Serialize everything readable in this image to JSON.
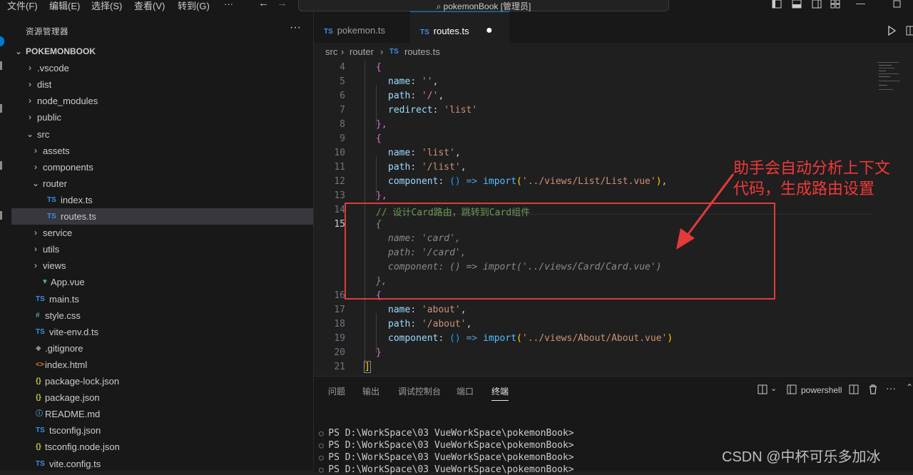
{
  "titlebar": {
    "menus": [
      "文件(F)",
      "编辑(E)",
      "选择(S)",
      "查看(V)",
      "转到(G)",
      "···"
    ],
    "search_text": "pokemonBook [管理员]"
  },
  "sidebar": {
    "title": "资源管理器",
    "more": "···",
    "items": [
      {
        "label": "POKEMONBOOK",
        "chev": "⌄",
        "icon": ""
      },
      {
        "label": ".vscode",
        "chev": "›",
        "icon": ""
      },
      {
        "label": "dist",
        "chev": "›",
        "icon": ""
      },
      {
        "label": "node_modules",
        "chev": "›",
        "icon": ""
      },
      {
        "label": "public",
        "chev": "›",
        "icon": ""
      },
      {
        "label": "src",
        "chev": "⌄",
        "icon": ""
      },
      {
        "label": "assets",
        "chev": "›",
        "icon": ""
      },
      {
        "label": "components",
        "chev": "›",
        "icon": ""
      },
      {
        "label": "router",
        "chev": "⌄",
        "icon": ""
      },
      {
        "label": "index.ts",
        "chev": "",
        "icon": "TS"
      },
      {
        "label": "routes.ts",
        "chev": "",
        "icon": "TS"
      },
      {
        "label": "service",
        "chev": "›",
        "icon": ""
      },
      {
        "label": "utils",
        "chev": "›",
        "icon": ""
      },
      {
        "label": "views",
        "chev": "›",
        "icon": ""
      },
      {
        "label": "App.vue",
        "chev": "",
        "icon": "▼"
      },
      {
        "label": "main.ts",
        "chev": "",
        "icon": "TS"
      },
      {
        "label": "style.css",
        "chev": "",
        "icon": "#"
      },
      {
        "label": "vite-env.d.ts",
        "chev": "",
        "icon": "TS"
      },
      {
        "label": ".gitignore",
        "chev": "",
        "icon": "◆"
      },
      {
        "label": "index.html",
        "chev": "",
        "icon": "<>"
      },
      {
        "label": "package-lock.json",
        "chev": "",
        "icon": "{}"
      },
      {
        "label": "package.json",
        "chev": "",
        "icon": "{}"
      },
      {
        "label": "README.md",
        "chev": "",
        "icon": "ⓘ"
      },
      {
        "label": "tsconfig.json",
        "chev": "",
        "icon": "TS"
      },
      {
        "label": "tsconfig.node.json",
        "chev": "",
        "icon": "{}"
      },
      {
        "label": "vite.config.ts",
        "chev": "",
        "icon": "TS"
      }
    ]
  },
  "tabs": [
    {
      "icon": "TS",
      "label": "pokemon.ts"
    },
    {
      "icon": "TS",
      "label": "routes.ts"
    }
  ],
  "breadcrumb": {
    "a": "src",
    "b": "router",
    "icon": "TS",
    "c": "routes.ts"
  },
  "line_numbers": [
    "4",
    "5",
    "6",
    "7",
    "8",
    "9",
    "10",
    "11",
    "12",
    "13",
    "14",
    "15",
    "16",
    "17",
    "18",
    "19",
    "20",
    "21"
  ],
  "code": {
    "l4": "{",
    "l5_key": "name",
    "l5_val": "''",
    "l6_key": "path",
    "l6_val": "'/'",
    "l7_key": "redirect",
    "l7_val": "'list'",
    "l8": "},",
    "l9": "{",
    "l10_key": "name",
    "l10_val": "'list'",
    "l11_key": "path",
    "l11_val": "'/list'",
    "l12_key": "component",
    "l12_paren": "()",
    "l12_arrow": "=>",
    "l12_import": "import",
    "l12_path": "'../views/List/List.vue'",
    "l13": "},",
    "l14_comment": "// 设计Card路由，跳转到Card组件",
    "g1": "{",
    "g2": "name: 'card',",
    "g3": "path: '/card',",
    "g4": "component: () => import('../views/Card/Card.vue')",
    "g5": "},",
    "l16": "{",
    "l17_key": "name",
    "l17_val": "'about'",
    "l18_key": "path",
    "l18_val": "'/about'",
    "l19_key": "component",
    "l19_paren": "()",
    "l19_arrow": "=>",
    "l19_import": "import",
    "l19_path": "'../views/About/About.vue'",
    "l20": "}",
    "l21": "]"
  },
  "panel": {
    "tabs": [
      "问题",
      "输出",
      "调试控制台",
      "端口",
      "终端"
    ],
    "shell": "powershell",
    "lines": [
      "PS D:\\WorkSpace\\03 VueWorkSpace\\pokemonBook>",
      "PS D:\\WorkSpace\\03 VueWorkSpace\\pokemonBook>",
      "PS D:\\WorkSpace\\03 VueWorkSpace\\pokemonBook>",
      "PS D:\\WorkSpace\\03 VueWorkSpace\\pokemonBook>"
    ]
  },
  "annotation": {
    "text": "助手会自动分析上下文代码，生成路由设置"
  },
  "watermark": "CSDN @中杯可乐多加冰",
  "colors": {
    "accent": "#0078d4",
    "annotation": "#e33a3a"
  }
}
